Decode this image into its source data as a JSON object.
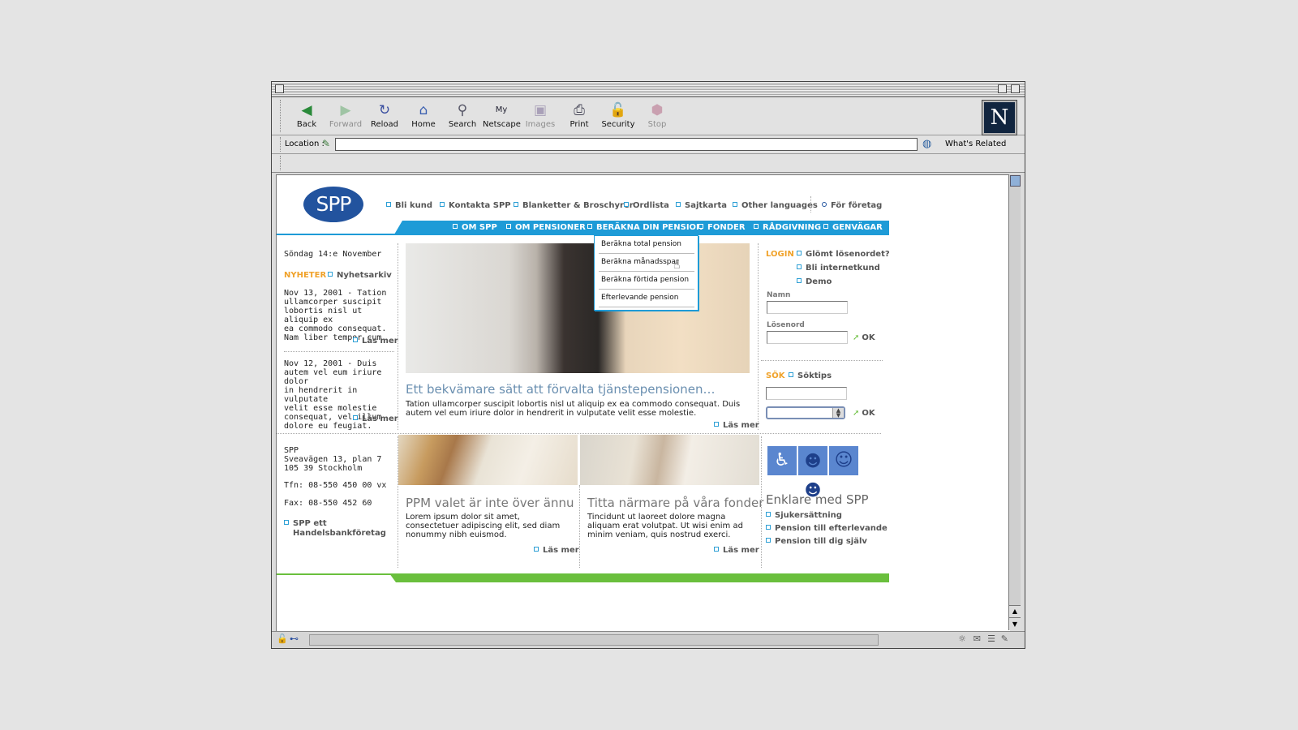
{
  "browser": {
    "toolbar": [
      {
        "label": "Back",
        "icon": "back-arrow-icon",
        "enabled": true
      },
      {
        "label": "Forward",
        "icon": "forward-arrow-icon",
        "enabled": false
      },
      {
        "label": "Reload",
        "icon": "reload-icon",
        "enabled": true
      },
      {
        "label": "Home",
        "icon": "home-icon",
        "enabled": true
      },
      {
        "label": "Search",
        "icon": "search-icon",
        "enabled": true
      },
      {
        "label": "Netscape",
        "icon": "my-netscape-icon",
        "enabled": true
      },
      {
        "label": "Images",
        "icon": "images-icon",
        "enabled": false
      },
      {
        "label": "Print",
        "icon": "print-icon",
        "enabled": true
      },
      {
        "label": "Security",
        "icon": "security-lock-icon",
        "enabled": true
      },
      {
        "label": "Stop",
        "icon": "stop-icon",
        "enabled": false
      }
    ],
    "netscape_logo": "N",
    "location_label": "Location :",
    "location_value": "",
    "whats_related": "What's Related"
  },
  "site": {
    "logo": "SPP",
    "top_links": [
      "Bli kund",
      "Kontakta SPP",
      "Blanketter & Broschyrer",
      "Ordlista",
      "Sajtkarta",
      "Other languages"
    ],
    "for_foretag": "För företag",
    "main_nav": [
      "OM SPP",
      "OM PENSIONER",
      "BERÄKNA DIN PENSION",
      "FONDER",
      "RÅDGIVNING",
      "GENVÄGAR"
    ],
    "dropdown": [
      "Beräkna total pension",
      "Beräkna månadsspar",
      "Beräkna förtida pension",
      "Efterlevande pension"
    ],
    "date": "Söndag 14:e November",
    "news_heading": "NYHETER",
    "news_archive": "Nyhetsarkiv",
    "news": [
      {
        "lines": [
          "Nov 13, 2001 - Tation",
          "ullamcorper suscipit",
          "lobortis nisl ut aliquip ex",
          "ea commodo consequat.",
          "Nam liber tempor cum."
        ],
        "more": "Läs mer"
      },
      {
        "lines": [
          "Nov 12, 2001 - Duis",
          "autem vel eum iriure dolor",
          "in hendrerit in vulputate",
          "velit esse molestie",
          "consequat, vel illum",
          "dolore eu feugiat."
        ],
        "more": "Läs mer"
      }
    ],
    "hero": {
      "title": "Ett bekvämare sätt att förvalta tjänstepensionen…",
      "lines": [
        "Tation ullamcorper suscipit lobortis nisl ut aliquip ex ea commodo consequat. Duis",
        "autem vel eum iriure dolor in hendrerit in vulputate velit esse molestie."
      ],
      "more": "Läs mer"
    },
    "login": {
      "heading": "LOGIN",
      "links": [
        "Glömt lösenordet?",
        "Bli internetkund",
        "Demo"
      ],
      "name_label": "Namn",
      "password_label": "Lösenord",
      "ok": "OK"
    },
    "search": {
      "heading": "SÖK",
      "tips": "Söktips",
      "ok": "OK"
    },
    "address": {
      "lines": [
        "SPP",
        "Sveavägen 13, plan 7",
        "105 39 Stockholm"
      ],
      "phone": "Tfn: 08-550 450 00 vx",
      "fax": "Fax: 08-550 452 60",
      "link_lines": [
        "SPP ett",
        "Handelsbankföretag"
      ]
    },
    "ppm": {
      "title": "PPM valet är inte över ännu",
      "lines": [
        "Lorem ipsum dolor sit amet,",
        "consectetuer adipiscing elit, sed diam",
        "nonummy nibh euismod."
      ],
      "more": "Läs mer"
    },
    "fonder": {
      "title": "Titta närmare på våra fonder",
      "lines": [
        "Tincidunt ut laoreet dolore magna",
        "aliquam erat volutpat. Ut wisi enim ad",
        "minim veniam, quis nostrud exerci."
      ],
      "more": "Läs mer"
    },
    "enklare": {
      "title": "Enklare med SPP",
      "links": [
        "Sjukersättning",
        "Pension  till efterlevande",
        "Pension till dig själv"
      ]
    }
  },
  "colors": {
    "accent_blue": "#1e9bd7",
    "logo_blue": "#22539e",
    "orange": "#f0a22a",
    "green": "#6abf3d"
  }
}
